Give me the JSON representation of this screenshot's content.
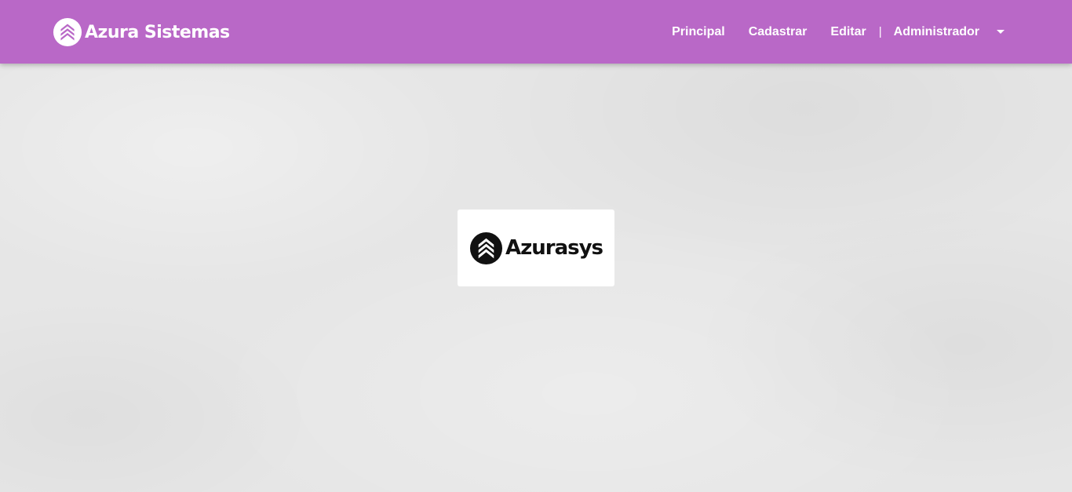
{
  "brand": {
    "name": "Azura Sistemas",
    "icon": "azura-chevrons-logo"
  },
  "nav": {
    "items": [
      {
        "label": "Principal"
      },
      {
        "label": "Cadastrar"
      },
      {
        "label": "Editar"
      }
    ],
    "divider": "|",
    "user_menu": {
      "label": "Administrador",
      "icon": "caret-down-icon"
    }
  },
  "main": {
    "logo_text": "Azurasys",
    "logo_icon": "azurasys-chevrons-logo"
  },
  "colors": {
    "navbar": "#b968c7",
    "nav_text": "#ffffff",
    "background": "#e6e6e6",
    "card": "#ffffff",
    "logo_dark": "#111111"
  }
}
